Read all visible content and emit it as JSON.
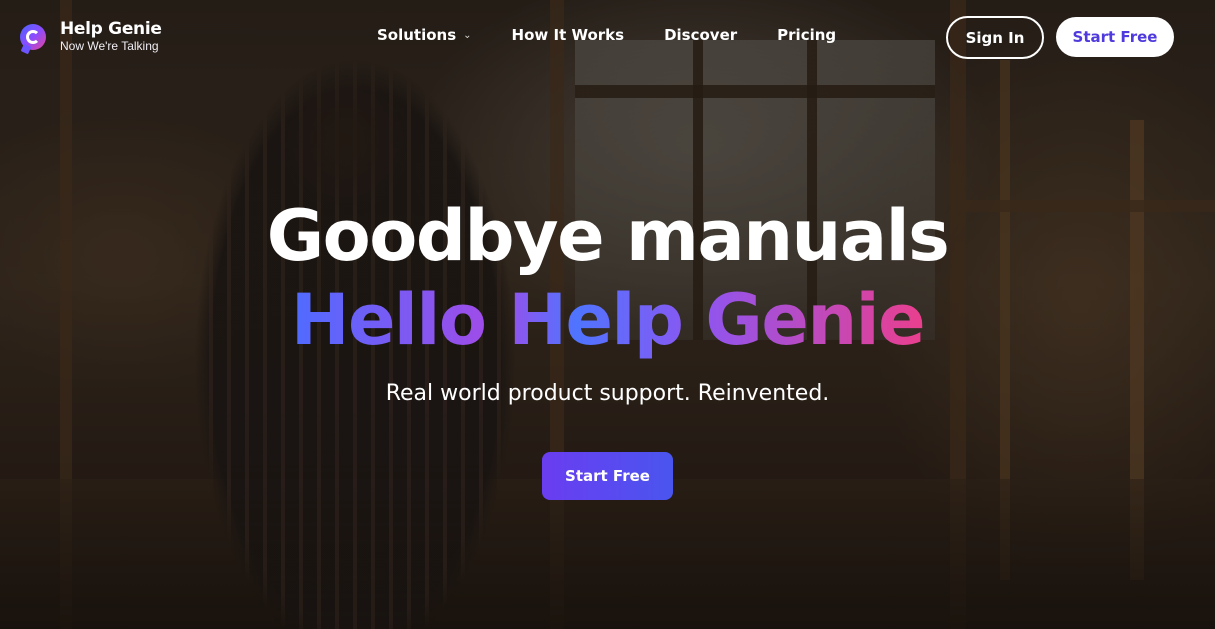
{
  "brand": {
    "name": "Help Genie",
    "tagline": "Now We're Talking",
    "logo_icon": "help-genie-logo-icon"
  },
  "nav": {
    "items": [
      {
        "label": "Solutions",
        "has_dropdown": true
      },
      {
        "label": "How It Works",
        "has_dropdown": false
      },
      {
        "label": "Discover",
        "has_dropdown": false
      },
      {
        "label": "Pricing",
        "has_dropdown": false
      }
    ],
    "dropdown_icon": "chevron-down-icon"
  },
  "header_actions": {
    "sign_in_label": "Sign In",
    "start_free_label": "Start Free"
  },
  "hero": {
    "headline_line1": "Goodbye manuals",
    "headline_line2": "Hello Help Genie",
    "subheadline": "Real world product support. Reinvented.",
    "cta_label": "Start Free"
  },
  "colors": {
    "accent_purple": "#6a3df0",
    "accent_blue": "#4a55ef",
    "gradient_start": "#4f6bff",
    "gradient_end": "#ea3f8d",
    "start_free_text": "#4f3bdd"
  }
}
